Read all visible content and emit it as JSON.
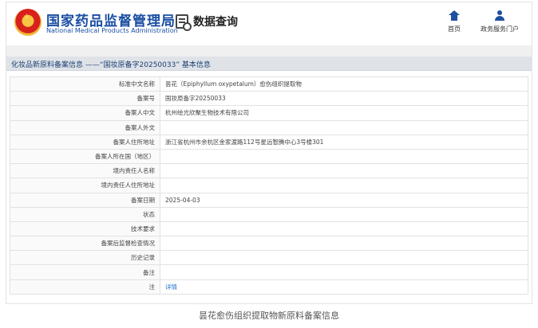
{
  "header": {
    "brand_cn": "国家药品监督管理局",
    "brand_en": "National Medical Products Administration",
    "data_query_label": "数据查询",
    "nav": [
      {
        "label": "首页",
        "icon": "home-icon"
      },
      {
        "label": "政务服务门户",
        "icon": "user-icon"
      }
    ]
  },
  "section": {
    "title": "化妆品新原料备案信息 ——“国妆原备字20250033” 基本信息"
  },
  "rows": [
    {
      "label": "标准中文名称",
      "value": "昙花（Epiphyllum oxypetalum）愈伤组织提取物"
    },
    {
      "label": "备案号",
      "value": "国妆原备字20250033"
    },
    {
      "label": "备案人中文",
      "value": "杭州绘光欣聚生物技术有限公司"
    },
    {
      "label": "备案人外文",
      "value": ""
    },
    {
      "label": "备案人住所地址",
      "value": "浙江省杭州市余杭区金家渡路112号星远智腾中心3号楼301"
    },
    {
      "label": "备案人所在国（地区）",
      "value": ""
    },
    {
      "label": "境内责任人名称",
      "value": ""
    },
    {
      "label": "境内责任人住所地址",
      "value": ""
    },
    {
      "label": "备案日期",
      "value": "2025-04-03"
    },
    {
      "label": "状态",
      "value": ""
    },
    {
      "label": "技术要求",
      "value": ""
    },
    {
      "label": "备案后监督检查情况",
      "value": ""
    },
    {
      "label": "历史记录",
      "value": ""
    },
    {
      "label": "备注",
      "value": ""
    },
    {
      "label": "注",
      "value": "详情",
      "is_link": true
    }
  ],
  "caption": "昙花愈伤组织提取物新原料备案信息",
  "colors": {
    "brand_blue": "#1b4ea3",
    "link_blue": "#1e6fc8",
    "section_bg": "#dfe3e8"
  }
}
